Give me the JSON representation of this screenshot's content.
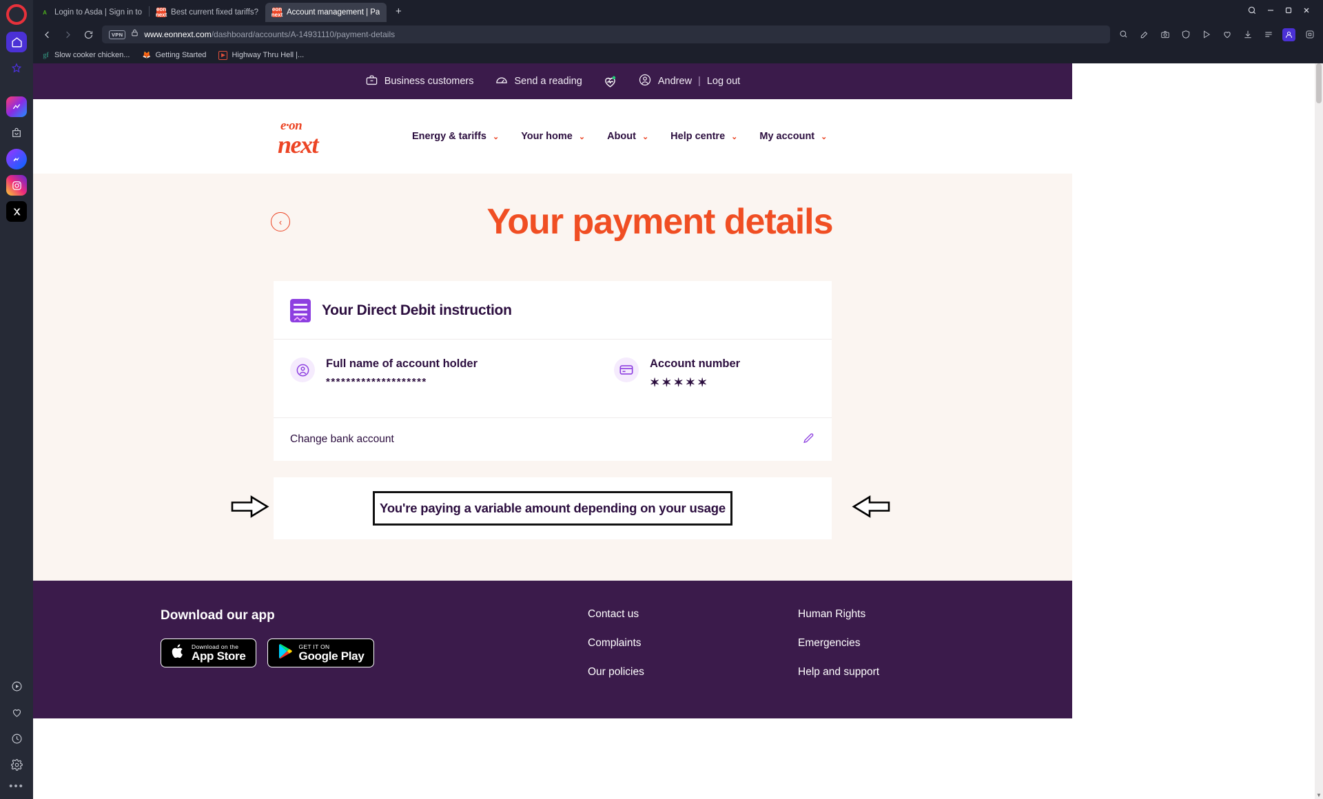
{
  "browser": {
    "tabs": [
      {
        "title": "Login to Asda | Sign in to",
        "icon": "asda-favicon",
        "active": false
      },
      {
        "title": "Best current fixed tariffs?",
        "icon": "eon-favicon",
        "active": false
      },
      {
        "title": "Account management | Pa",
        "icon": "eon-favicon",
        "active": true
      }
    ],
    "new_tab_label": "+",
    "window_controls": [
      "minimize",
      "maximize",
      "close"
    ],
    "search_icon": "search-icon",
    "nav": {
      "back": "back-icon",
      "forward": "forward-icon",
      "reload": "reload-icon"
    },
    "address": {
      "vpn_badge": "VPN",
      "lock_icon": "lock-icon",
      "domain": "www.eonnext.com",
      "path": "/dashboard/accounts/A-14931110/payment-details"
    },
    "toolbar_right_icons": [
      "zoom-search-icon",
      "edit-icon",
      "screenshot-icon",
      "shield-icon",
      "player-icon",
      "heart-icon",
      "download-icon",
      "menu-icon",
      "profile-icon",
      "extensions-icon"
    ],
    "bookmarks": [
      {
        "label": "Slow cooker chicken...",
        "icon": "goodfood-icon"
      },
      {
        "label": "Getting Started",
        "icon": "firefox-icon"
      },
      {
        "label": "Highway Thru Hell |...",
        "icon": "video-icon"
      }
    ]
  },
  "sidebar": {
    "logo": "opera-logo",
    "items": [
      {
        "name": "home",
        "icon": "home-icon",
        "active": true
      },
      {
        "name": "bookmarks",
        "icon": "star-icon",
        "active": false
      },
      {
        "name": "aria",
        "icon": "aria-icon",
        "active": true
      },
      {
        "name": "shopping",
        "icon": "shopping-bag-icon",
        "active": false
      },
      {
        "name": "messenger",
        "icon": "messenger-icon",
        "active": true
      },
      {
        "name": "instagram",
        "icon": "instagram-icon",
        "active": true
      },
      {
        "name": "x-twitter",
        "icon": "x-icon",
        "active": true
      },
      {
        "name": "player",
        "icon": "play-circle-icon",
        "active": false
      },
      {
        "name": "favourites",
        "icon": "heart-icon",
        "active": false
      },
      {
        "name": "history",
        "icon": "clock-icon",
        "active": false
      },
      {
        "name": "settings",
        "icon": "gear-icon",
        "active": false
      },
      {
        "name": "more",
        "icon": "more-dots-icon",
        "active": false
      }
    ]
  },
  "page": {
    "utility_bar": {
      "business": "Business customers",
      "reading": "Send a reading",
      "user": "Andrew",
      "separator": "|",
      "logout": "Log out"
    },
    "logo": {
      "top": "e·on",
      "bottom": "next"
    },
    "nav": [
      {
        "label": "Energy & tariffs"
      },
      {
        "label": "Your home"
      },
      {
        "label": "About"
      },
      {
        "label": "Help centre"
      },
      {
        "label": "My account"
      }
    ],
    "hero_title": "Your payment details",
    "direct_debit": {
      "heading": "Your Direct Debit instruction",
      "account_holder_label": "Full name of account holder",
      "account_holder_value": "********************",
      "account_number_label": "Account number",
      "account_number_value": "✶✶✶✶✶",
      "change_bank_label": "Change bank account"
    },
    "payment_notice": "You're paying a variable amount depending on your usage",
    "footer": {
      "app_heading": "Download our app",
      "app_store": {
        "line1": "Download on the",
        "line2": "App Store"
      },
      "google_play": {
        "line1": "GET IT ON",
        "line2": "Google Play"
      },
      "links_col2": [
        "Contact us",
        "Complaints",
        "Our policies"
      ],
      "links_col3": [
        "Human Rights",
        "Emergencies",
        "Help and support"
      ]
    }
  },
  "colors": {
    "brand_orange": "#f04e23",
    "brand_purple": "#3b1b4b",
    "accent_violet": "#8d3fe0",
    "page_bg": "#fbf5f1"
  }
}
